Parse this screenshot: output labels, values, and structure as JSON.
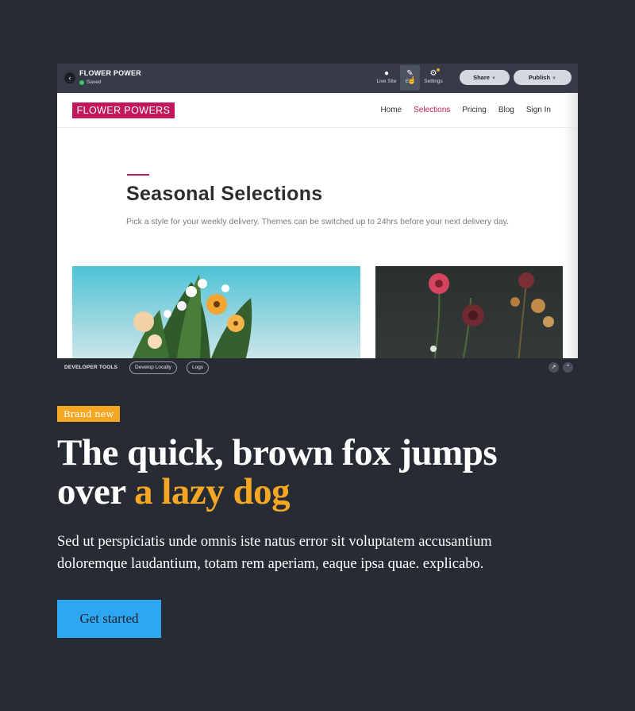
{
  "editor": {
    "site_name": "FLOWER POWER",
    "status": "Saved",
    "tools": {
      "live_site": "Live Site",
      "edit": "Edit",
      "settings": "Settings"
    },
    "share_label": "Share",
    "publish_label": "Publish"
  },
  "preview": {
    "logo": "FLOWER POWERS",
    "nav": [
      "Home",
      "Selections",
      "Pricing",
      "Blog",
      "Sign In"
    ],
    "active_nav": "Selections",
    "title": "Seasonal Selections",
    "description": "Pick a style for your weekly delivery. Themes can be switched up to 24hrs before your next delivery day."
  },
  "devtools": {
    "title": "DEVELOPER TOOLS",
    "develop_locally": "Develop Locally",
    "logs": "Logs"
  },
  "hero": {
    "badge": "Brand new",
    "headline_part1": "The quick, brown fox jumps over ",
    "headline_highlight": "a lazy dog",
    "body": "Sed ut perspiciatis unde omnis iste natus error sit voluptatem accusantium doloremque laudantium, totam rem aperiam, eaque ipsa quae. explicabo.",
    "cta": "Get started"
  },
  "colors": {
    "page_bg": "#262b34",
    "accent_orange": "#f5a623",
    "brand_magenta": "#c2185b",
    "cta_blue": "#2ea7f2"
  },
  "icons": [
    "back-icon",
    "globe-icon",
    "pencil-icon",
    "gear-icon",
    "pointer-cursor-icon",
    "saved-check-icon",
    "external-link-icon",
    "collapse-up-icon"
  ]
}
